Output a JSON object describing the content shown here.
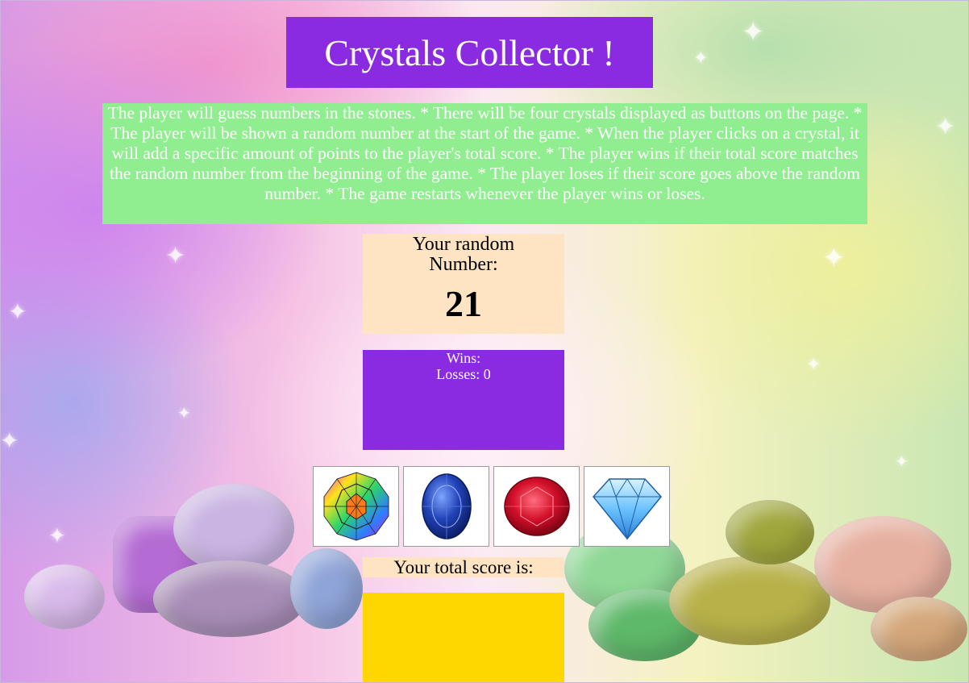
{
  "title": "Crystals Collector !",
  "instructions": "The player will guess numbers in the stones. * There will be four crystals displayed as buttons on the page. * The player will be shown a random number at the start of the game. * When the player clicks on a crystal, it will add a specific amount of points to the player's total score. * The player wins if their total score matches the random number from the beginning of the game. * The player loses if their score goes above the random number. * The game restarts whenever the player wins or loses.",
  "random": {
    "label": "Your random Number:",
    "value": "21"
  },
  "stats": {
    "wins_label": "Wins:",
    "wins_value": "",
    "losses_label": "Losses:",
    "losses_value": "0"
  },
  "crystals": [
    {
      "icon": "rainbow-crystal-icon"
    },
    {
      "icon": "blue-sapphire-icon"
    },
    {
      "icon": "red-ruby-icon"
    },
    {
      "icon": "blue-diamond-icon"
    }
  ],
  "score": {
    "label": "Your total score is:",
    "value": ""
  },
  "colors": {
    "purple": "#8a2be2",
    "green": "#90ee90",
    "bisque": "#ffe4c4",
    "gold": "#ffd700"
  }
}
